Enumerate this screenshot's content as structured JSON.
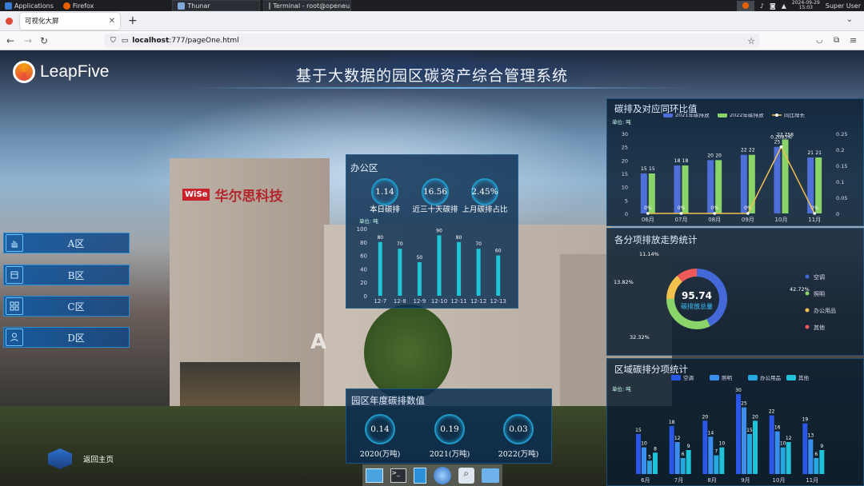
{
  "taskbar": {
    "apps_label": "Applications",
    "windows": [
      "Firefox",
      "Thunar",
      "Terminal - root@openeu..."
    ],
    "date": "2024-09-29",
    "time": "15:03",
    "user": "Super User"
  },
  "browser": {
    "tab_title": "可视化大屏",
    "url_host": "localhost",
    "url_rest": ":777/pageOne.html"
  },
  "header": {
    "logo": "LeapFive",
    "title": "基于大数据的园区碳资产综合管理系统"
  },
  "building_sign": {
    "brand": "WiSe",
    "name": "华尔思科技",
    "wall_letter": "A"
  },
  "sidebar": {
    "items": [
      {
        "label": "A区",
        "icon": "hand-icon"
      },
      {
        "label": "B区",
        "icon": "box-icon"
      },
      {
        "label": "C区",
        "icon": "grid-icon"
      },
      {
        "label": "D区",
        "icon": "person-icon"
      }
    ],
    "home_label": "返回主页"
  },
  "office": {
    "title": "办公区",
    "stats": [
      {
        "value": "1.14",
        "label": "本日碳排"
      },
      {
        "value": "16.56",
        "label": "近三十天碳排"
      },
      {
        "value": "2.45%",
        "label": "上月碳排占比"
      }
    ],
    "unit": "单位: 吨"
  },
  "annual": {
    "title": "园区年度碳排数值",
    "items": [
      {
        "value": "0.14",
        "label": "2020(万吨)"
      },
      {
        "value": "0.19",
        "label": "2021(万吨)"
      },
      {
        "value": "0.03",
        "label": "2022(万吨)"
      }
    ]
  },
  "right1": {
    "title": "碳排及对应同环比值",
    "unit": "单位: 吨"
  },
  "right2": {
    "title": "各分项排放走势统计",
    "center_value": "95.74",
    "center_label": "碳排放总量"
  },
  "right3": {
    "title": "区域碳排分项统计",
    "unit": "单位: 吨"
  },
  "chart_data": [
    {
      "type": "bar",
      "categories": [
        "12-7",
        "12-8",
        "12-9",
        "12-10",
        "12-11",
        "12-12",
        "12-13"
      ],
      "values": [
        80,
        70,
        50,
        90,
        80,
        70,
        60
      ],
      "ylim": [
        0,
        100
      ],
      "yticks": [
        0,
        20,
        40,
        60,
        80,
        100
      ],
      "color": "#1fc6d8"
    },
    {
      "type": "bar",
      "categories": [
        "06月",
        "07月",
        "08月",
        "09月",
        "10月",
        "11月"
      ],
      "series": [
        {
          "name": "2021年碳排放",
          "values": [
            15,
            18,
            20,
            22,
            25,
            21
          ],
          "color": "#4f6fd8"
        },
        {
          "name": "2022年碳排放",
          "values": [
            15,
            18,
            20,
            22,
            27.758,
            21
          ],
          "color": "#8ad46a"
        },
        {
          "name": "同比增长",
          "values": [
            0,
            0,
            0,
            0,
            0.2083,
            0
          ],
          "color": "#f2c14e",
          "type": "line"
        }
      ],
      "bar_labels": [
        "15",
        "15",
        "18",
        "18",
        "20",
        "20",
        "22",
        "22",
        "25",
        "27.758",
        "21",
        "21"
      ],
      "pct_labels": [
        "0%",
        "0%",
        "0%",
        "0%",
        "0.2083%",
        "0%"
      ],
      "ylim": [
        0,
        30
      ],
      "yticks": [
        0,
        5,
        10,
        15,
        20,
        25,
        30
      ],
      "y2lim": [
        0,
        0.25
      ],
      "y2ticks": [
        "0",
        "0.05",
        "0.1",
        "0.15",
        "0.2",
        "0.25"
      ]
    },
    {
      "type": "pie",
      "slices": [
        {
          "name": "空调",
          "value": 42.72,
          "label": "42.72%",
          "color": "#4468d8"
        },
        {
          "name": "照明",
          "value": 32.32,
          "label": "32.32%",
          "color": "#8ad46a"
        },
        {
          "name": "办公用品",
          "value": 13.82,
          "label": "13.82%",
          "color": "#f2c14e"
        },
        {
          "name": "其他",
          "value": 11.14,
          "label": "11.14%",
          "color": "#ee5a5a"
        }
      ]
    },
    {
      "type": "bar",
      "categories": [
        "6月",
        "7月",
        "8月",
        "9月",
        "10月",
        "11月"
      ],
      "series": [
        {
          "name": "空调",
          "values": [
            15,
            18,
            20,
            30,
            22,
            19
          ],
          "color": "#2b57e8"
        },
        {
          "name": "照明",
          "values": [
            10,
            12,
            14,
            25,
            16,
            13
          ],
          "color": "#3b8ef0"
        },
        {
          "name": "办公用品",
          "values": [
            5,
            6,
            7,
            15,
            10,
            6
          ],
          "color": "#27a7e0"
        },
        {
          "name": "其他",
          "values": [
            8,
            9,
            10,
            20,
            12,
            9
          ],
          "color": "#20c2d8"
        }
      ],
      "ylim": [
        0,
        30
      ]
    }
  ],
  "dock": [
    "screen-icon",
    "terminal-icon",
    "files-icon",
    "browser-icon",
    "search-icon",
    "folder-icon"
  ]
}
